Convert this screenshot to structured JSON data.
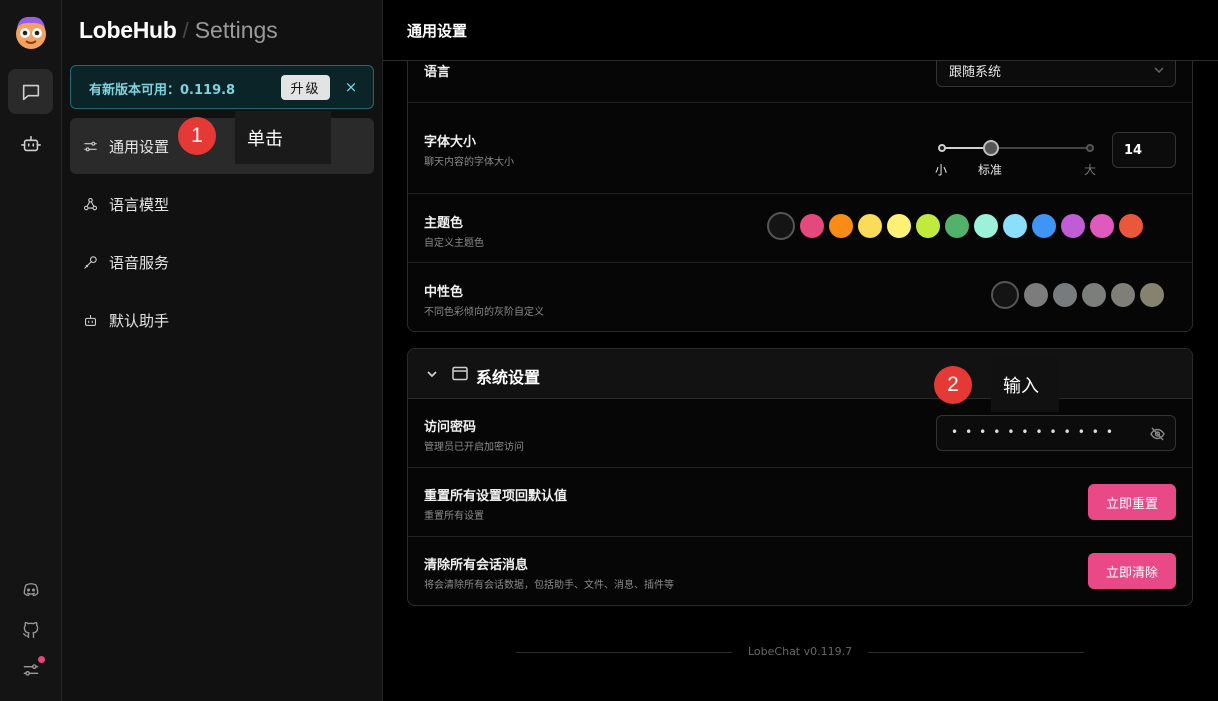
{
  "sidebar": {
    "brand": "LobeHub",
    "separator": "/",
    "section": "Settings",
    "update_banner": {
      "text": "有新版本可用：0.119.8",
      "upgrade_label": "升级",
      "close_label": "×"
    },
    "items": [
      {
        "label": "通用设置",
        "icon": "sliders-icon",
        "active": true
      },
      {
        "label": "语言模型",
        "icon": "webhook-icon"
      },
      {
        "label": "语音服务",
        "icon": "mic-icon"
      },
      {
        "label": "默认助手",
        "icon": "bot-icon"
      }
    ]
  },
  "annotations": [
    {
      "number": "1",
      "text": "单击"
    },
    {
      "number": "2",
      "text": "输入"
    }
  ],
  "main": {
    "title": "通用设置",
    "general": {
      "language": {
        "title": "语言",
        "value": "跟随系统"
      },
      "font_size": {
        "title": "字体大小",
        "desc": "聊天内容的字体大小",
        "marks": {
          "small": "小",
          "standard": "标准",
          "large": "大"
        },
        "value": "14",
        "slider_position": 0.33
      },
      "theme_color": {
        "title": "主题色",
        "desc": "自定义主题色",
        "colors": [
          "#141414",
          "#e5487d",
          "#fa8c16",
          "#fadb5a",
          "#fff176",
          "#c0eb3c",
          "#52b26b",
          "#9cf2d8",
          "#8bdefc",
          "#3f95f5",
          "#bf5dd4",
          "#e05abd",
          "#ea573a"
        ]
      },
      "neutral_color": {
        "title": "中性色",
        "desc": "不同色彩倾向的灰阶自定义",
        "colors": [
          "#141414",
          "#7c7c7c",
          "#787b7e",
          "#7b7e7a",
          "#7f7f78",
          "#85836f"
        ]
      }
    },
    "system": {
      "section_title": "系统设置",
      "password": {
        "title": "访问密码",
        "desc": "管理员已开启加密访问",
        "masked_value": "••••••••••••"
      },
      "reset": {
        "title": "重置所有设置项回默认值",
        "desc": "重置所有设置",
        "button": "立即重置"
      },
      "clear": {
        "title": "清除所有会话消息",
        "desc": "将会清除所有会话数据，包括助手、文件、消息、插件等",
        "button": "立即清除"
      }
    },
    "footer": "LobeChat v0.119.7"
  },
  "colors": {
    "accent_danger": "#e94a87",
    "banner_text": "#7fd3de",
    "marker": "#e53935"
  }
}
